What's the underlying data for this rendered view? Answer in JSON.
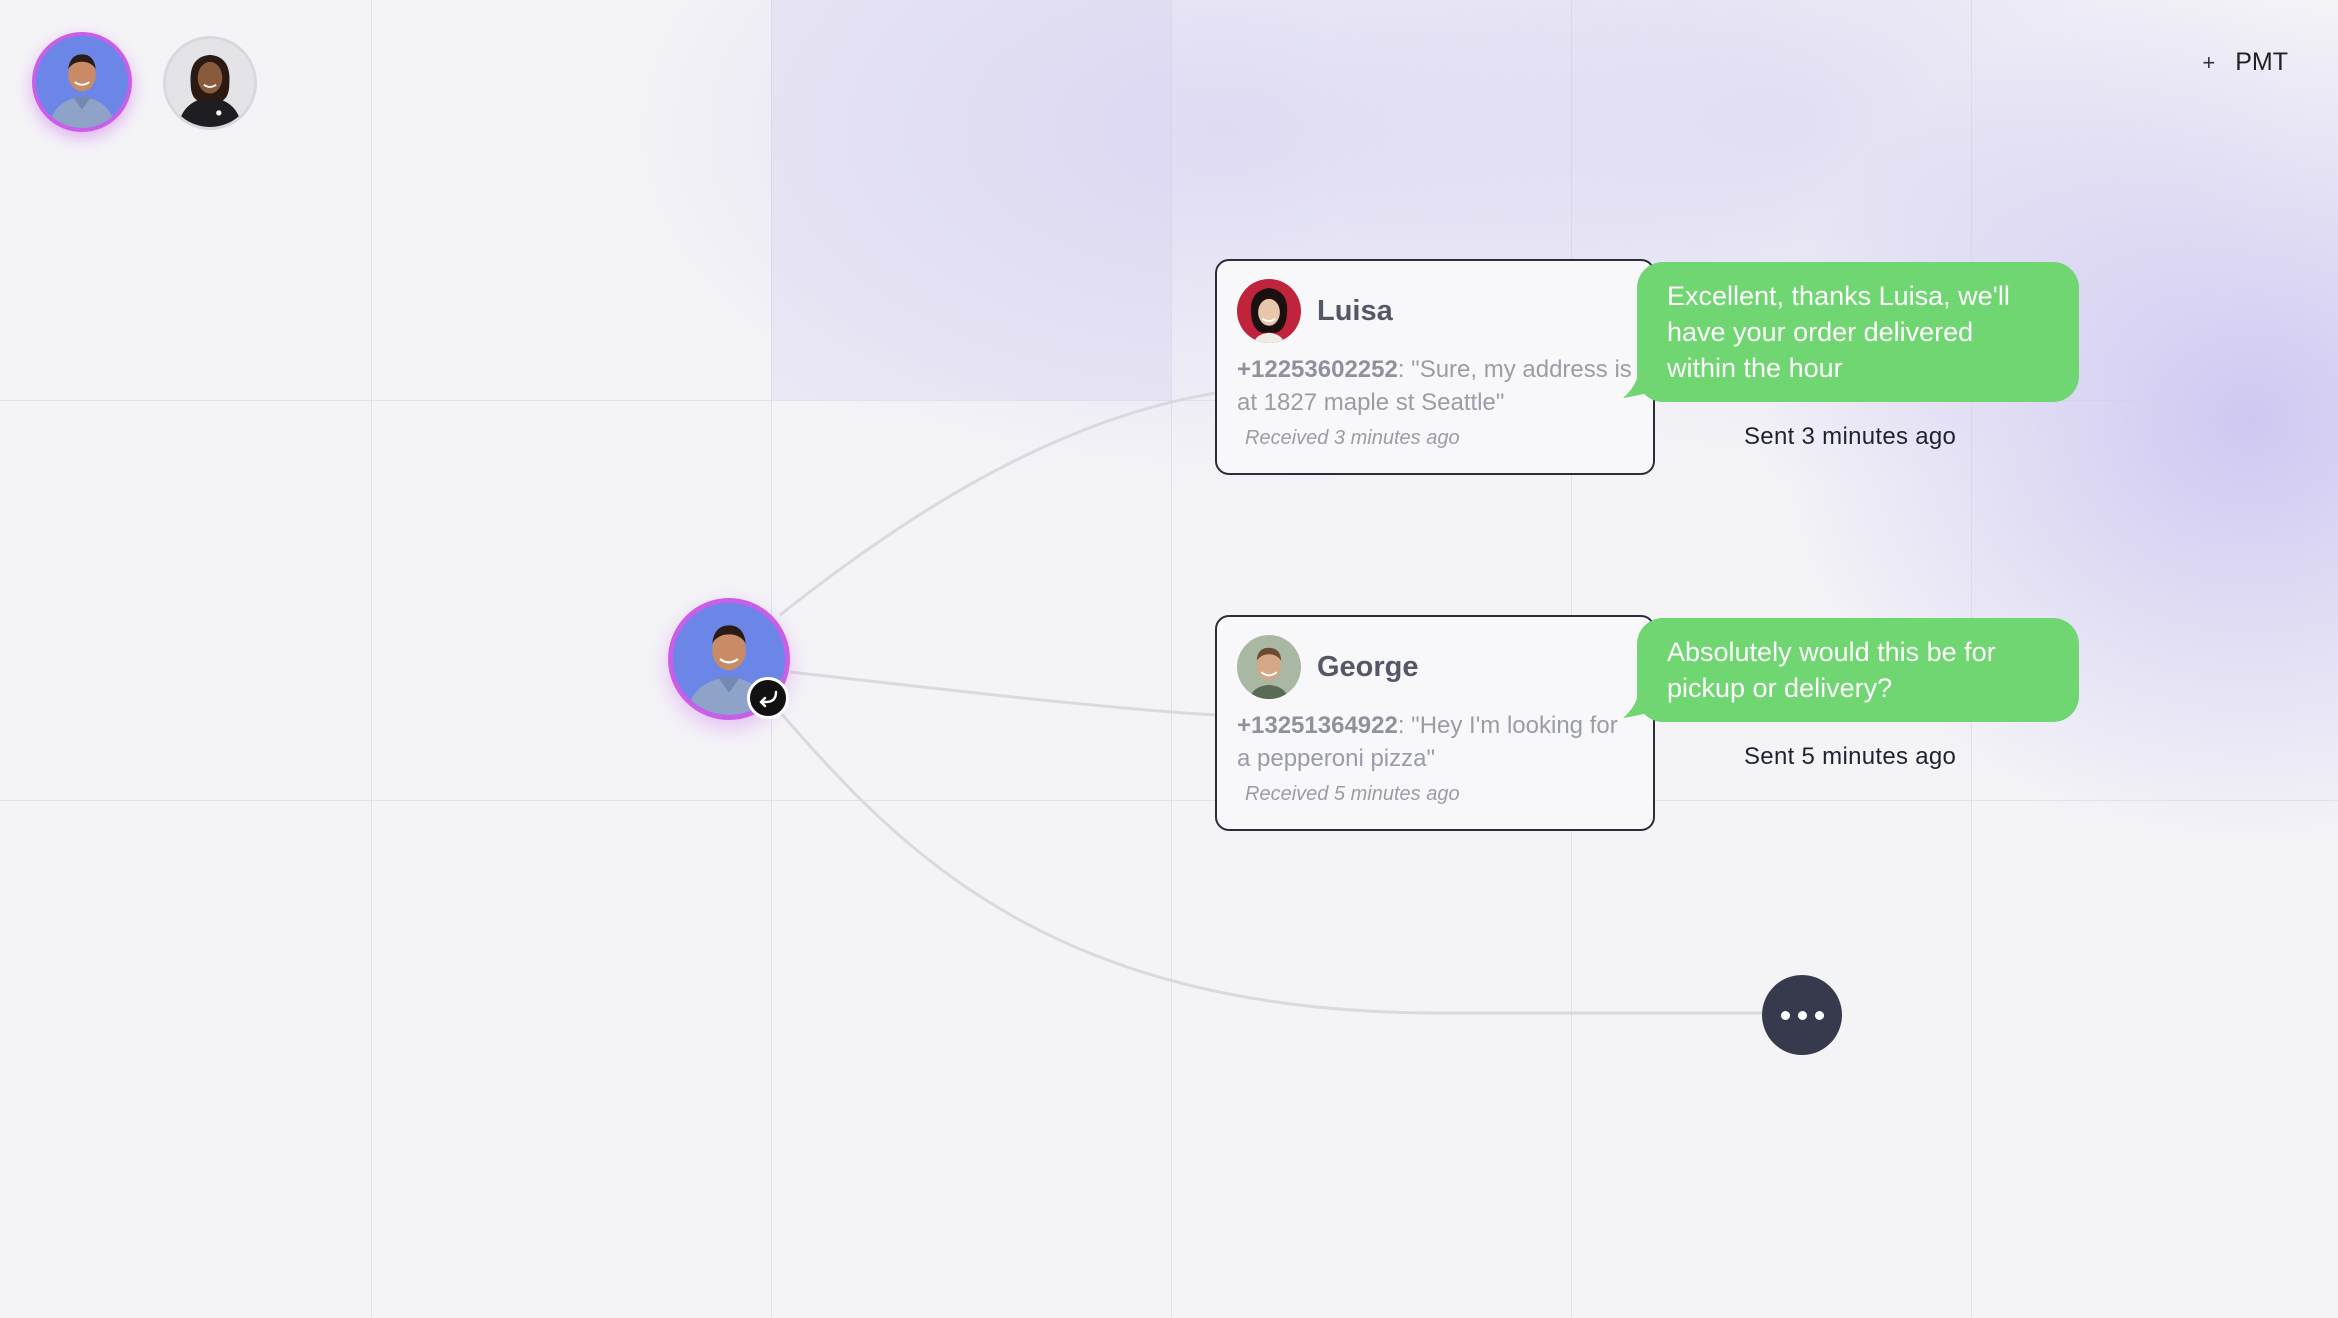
{
  "header": {
    "add_label": "PMT",
    "add_icon": "plus-icon"
  },
  "agents": [
    {
      "name": "agent-1",
      "active": true
    },
    {
      "name": "agent-2",
      "active": false
    }
  ],
  "conversations": [
    {
      "contact_name": "Luisa",
      "phone": "+12253602252",
      "message": ": \"Sure, my address is at 1827 maple st Seattle\"",
      "received": "Received 3 minutes ago",
      "reply": "Excellent, thanks Luisa, we'll have your order delivered within the hour",
      "sent": "Sent 3 minutes ago"
    },
    {
      "contact_name": "George",
      "phone": "+13251364922",
      "message": ": \"Hey I'm looking for a pepperoni pizza\"",
      "received": "Received 5 minutes ago",
      "reply": "Absolutely would this be for pickup or delivery?",
      "sent": "Sent 5 minutes ago"
    }
  ],
  "colors": {
    "accent": "#c95ee8",
    "bubble": "#6fd672",
    "more_button": "#363a4c"
  },
  "icons": {
    "hub_badge": "reply-arrow-icon",
    "more": "more-dots-icon"
  }
}
